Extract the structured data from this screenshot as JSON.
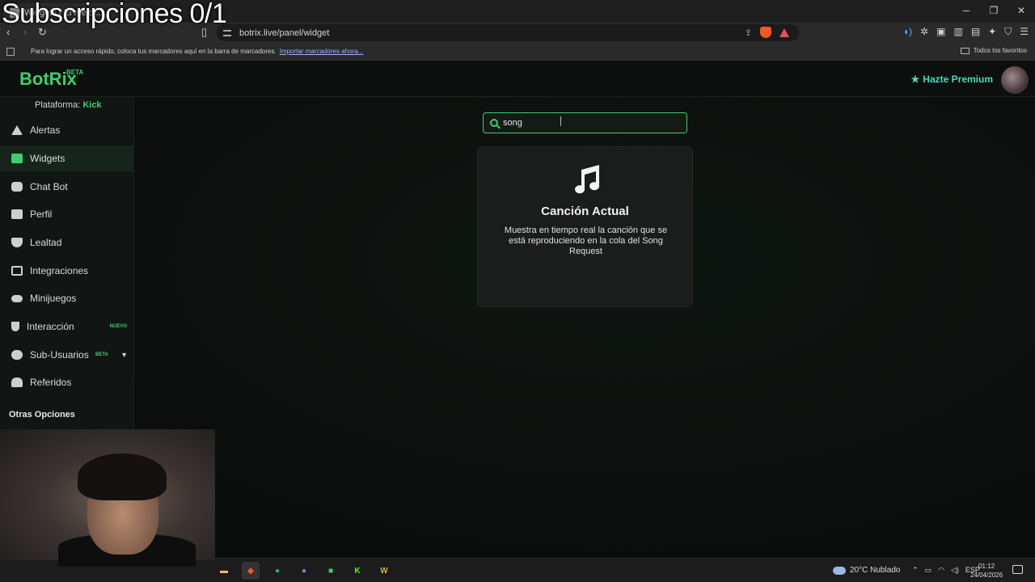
{
  "overlay": {
    "title": "Subscripciones 0/1"
  },
  "browser": {
    "tab_title": "Widgets | El mejor...",
    "url": "botrix.live/panel/widget",
    "bookmarks_hint": "Para lograr un acceso rápido, coloca tus marcadores aquí en la barra de marcadores.",
    "bookmarks_link": "Importar marcadores ahora...",
    "all_favorites": "Todos los favoritos"
  },
  "header": {
    "logo": "BotRix",
    "logo_badge": "BETA",
    "premium": "Hazte Premium"
  },
  "sidebar": {
    "platform_label": "Plataforma:",
    "platform_value": "Kick",
    "items": [
      {
        "label": "Alertas"
      },
      {
        "label": "Widgets"
      },
      {
        "label": "Chat Bot"
      },
      {
        "label": "Perfil"
      },
      {
        "label": "Lealtad"
      },
      {
        "label": "Integraciones"
      },
      {
        "label": "Minijuegos"
      },
      {
        "label": "Interacción",
        "badge": "NUEVO"
      },
      {
        "label": "Sub-Usuarios",
        "badge": "BETA"
      },
      {
        "label": "Referidos"
      }
    ],
    "other_options": "Otras Opciones"
  },
  "search": {
    "value": "song"
  },
  "widget_card": {
    "title": "Canción Actual",
    "description": "Muestra en tiempo real la canción que se está reproduciendo en la cola del Song Request"
  },
  "taskbar": {
    "weather": "20°C  Nublado",
    "lang": "ESP",
    "time": "01:12",
    "date": "24/04/2026"
  }
}
